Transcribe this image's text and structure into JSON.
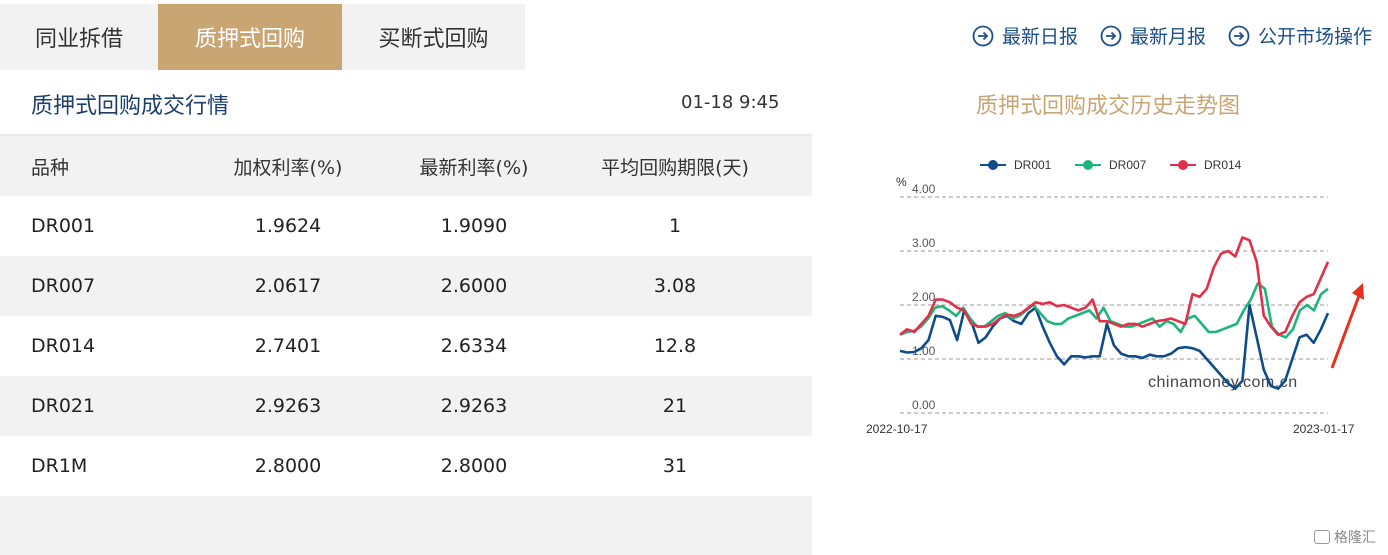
{
  "tabs": [
    {
      "label": "同业拆借",
      "active": false
    },
    {
      "label": "质押式回购",
      "active": true
    },
    {
      "label": "买断式回购",
      "active": false
    }
  ],
  "links": [
    {
      "label": "最新日报",
      "icon": "arrow-circle-icon"
    },
    {
      "label": "最新月报",
      "icon": "arrow-circle-icon"
    },
    {
      "label": "公开市场操作",
      "icon": "arrow-circle-icon"
    }
  ],
  "section": {
    "title": "质押式回购成交行情",
    "time": "01-18 9:45"
  },
  "table": {
    "headers": [
      "品种",
      "加权利率(%)",
      "最新利率(%)",
      "平均回购期限(天)"
    ],
    "rows": [
      [
        "DR001",
        "1.9624",
        "1.9090",
        "1"
      ],
      [
        "DR007",
        "2.0617",
        "2.6000",
        "3.08"
      ],
      [
        "DR014",
        "2.7401",
        "2.6334",
        "12.8"
      ],
      [
        "DR021",
        "2.9263",
        "2.9263",
        "21"
      ],
      [
        "DR1M",
        "2.8000",
        "2.8000",
        "31"
      ]
    ]
  },
  "chart_title": "质押式回购成交历史走势图",
  "badge_text": "格隆汇",
  "colors": {
    "accent": "#c9a574",
    "link": "#1c4f8a",
    "dr001": "#0f4c8a",
    "dr007": "#1fb57a",
    "dr014": "#e0304a",
    "annotation_arrow": "#e8301e"
  },
  "chart_data": {
    "type": "line",
    "ylabel": "%",
    "ylim": [
      0,
      4
    ],
    "yticks": [
      "4.00",
      "3.00",
      "2.00",
      "1.00",
      "0.00"
    ],
    "x_start": "2022-10-17",
    "x_end": "2023-01-17",
    "watermark": "chinamoney.com.cn",
    "legend_position": "top-center",
    "grid": true,
    "series": [
      {
        "name": "DR001",
        "values": [
          1.15,
          1.12,
          1.13,
          1.2,
          1.35,
          1.8,
          1.78,
          1.72,
          1.35,
          1.9,
          1.7,
          1.3,
          1.4,
          1.6,
          1.75,
          1.8,
          1.7,
          1.65,
          1.85,
          1.95,
          1.6,
          1.3,
          1.05,
          0.9,
          1.05,
          1.05,
          1.03,
          1.05,
          1.05,
          1.65,
          1.25,
          1.1,
          1.05,
          1.05,
          1.02,
          1.08,
          1.05,
          1.05,
          1.1,
          1.2,
          1.22,
          1.2,
          1.15,
          1.0,
          0.85,
          0.7,
          0.55,
          0.45,
          0.6,
          2.0,
          1.4,
          0.8,
          0.5,
          0.45,
          0.6,
          1.0,
          1.4,
          1.45,
          1.3,
          1.55,
          1.85
        ]
      },
      {
        "name": "DR007",
        "values": [
          1.45,
          1.5,
          1.52,
          1.6,
          1.75,
          1.95,
          1.98,
          1.9,
          1.8,
          1.95,
          1.75,
          1.6,
          1.6,
          1.7,
          1.8,
          1.85,
          1.75,
          1.8,
          1.9,
          2.0,
          1.85,
          1.7,
          1.65,
          1.65,
          1.75,
          1.8,
          1.85,
          1.9,
          1.75,
          1.95,
          1.7,
          1.65,
          1.6,
          1.6,
          1.65,
          1.7,
          1.75,
          1.6,
          1.7,
          1.65,
          1.5,
          1.75,
          1.8,
          1.65,
          1.5,
          1.5,
          1.55,
          1.6,
          1.65,
          1.9,
          2.1,
          2.4,
          2.3,
          1.6,
          1.45,
          1.4,
          1.55,
          1.9,
          2.0,
          1.9,
          2.2,
          2.3
        ]
      },
      {
        "name": "DR014",
        "values": [
          1.45,
          1.55,
          1.5,
          1.65,
          1.8,
          2.1,
          2.1,
          2.05,
          1.95,
          1.9,
          1.65,
          1.6,
          1.6,
          1.65,
          1.75,
          1.82,
          1.8,
          1.85,
          1.95,
          2.05,
          2.02,
          2.05,
          1.98,
          2.0,
          1.95,
          1.9,
          1.95,
          2.1,
          1.7,
          1.7,
          1.65,
          1.6,
          1.65,
          1.65,
          1.6,
          1.65,
          1.7,
          1.72,
          1.75,
          1.7,
          1.65,
          2.2,
          2.15,
          2.3,
          2.7,
          2.95,
          3.0,
          2.9,
          3.25,
          3.2,
          2.8,
          1.8,
          1.6,
          1.45,
          1.5,
          1.8,
          2.05,
          2.15,
          2.2,
          2.5,
          2.8
        ]
      }
    ]
  }
}
